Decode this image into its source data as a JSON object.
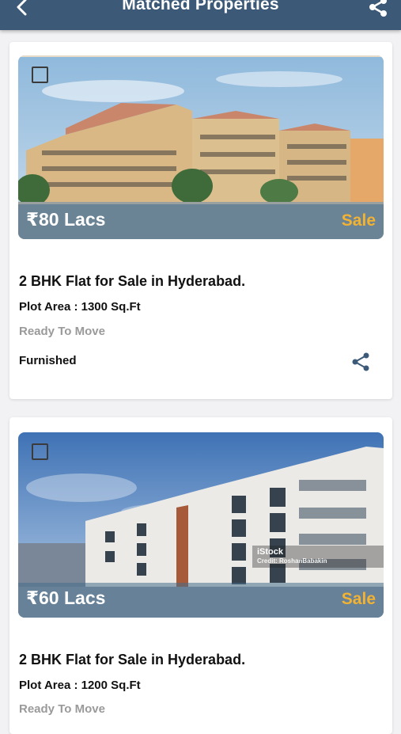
{
  "header": {
    "title": "Matched Properties",
    "back_icon": "back-arrow-icon",
    "share_icon": "share-icon"
  },
  "listings": [
    {
      "price": "₹80 Lacs",
      "tag": "Sale",
      "title": "2 BHK Flat for Sale in Hyderabad.",
      "plot_area": "Plot Area : 1300 Sq.Ft",
      "status": "Ready To Move",
      "furnishing": "Furnished"
    },
    {
      "price": "₹60 Lacs",
      "tag": "Sale",
      "title": "2 BHK Flat for Sale in Hyderabad.",
      "plot_area": "Plot Area : 1200 Sq.Ft",
      "status": "Ready To Move",
      "watermark": "iStock",
      "watermark_credit": "Credit: RoshanBabakin"
    }
  ],
  "colors": {
    "appbar": "#3c5a78",
    "sale_tag": "#f2b233",
    "share_icon": "#3c5a78"
  }
}
